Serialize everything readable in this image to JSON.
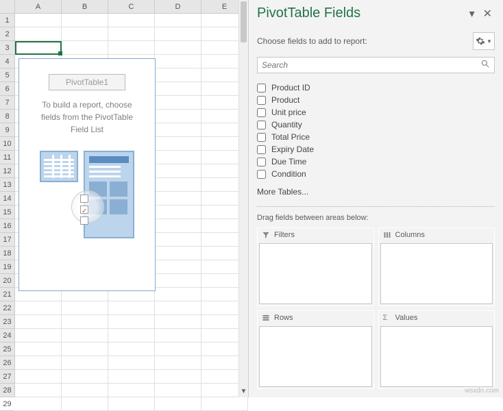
{
  "sheet": {
    "columns": [
      "A",
      "B",
      "C",
      "D",
      "E"
    ],
    "row_count": 29,
    "selected_cell": "A3",
    "pivot": {
      "title": "PivotTable1",
      "message": "To build a report, choose fields from the PivotTable Field List"
    }
  },
  "pane": {
    "title": "PivotTable Fields",
    "subtitle": "Choose fields to add to report:",
    "search_placeholder": "Search",
    "fields": [
      {
        "label": "Product ID",
        "checked": false
      },
      {
        "label": "Product",
        "checked": false
      },
      {
        "label": "Unit price",
        "checked": false
      },
      {
        "label": "Quantity",
        "checked": false
      },
      {
        "label": "Total Price",
        "checked": false
      },
      {
        "label": "Expiry Date",
        "checked": false
      },
      {
        "label": "Due Time",
        "checked": false
      },
      {
        "label": "Condition",
        "checked": false
      }
    ],
    "more_tables": "More Tables...",
    "drag_label": "Drag fields between areas below:",
    "areas": {
      "filters": "Filters",
      "columns": "Columns",
      "rows": "Rows",
      "values": "Values"
    }
  },
  "watermark": "wsxdn.com"
}
